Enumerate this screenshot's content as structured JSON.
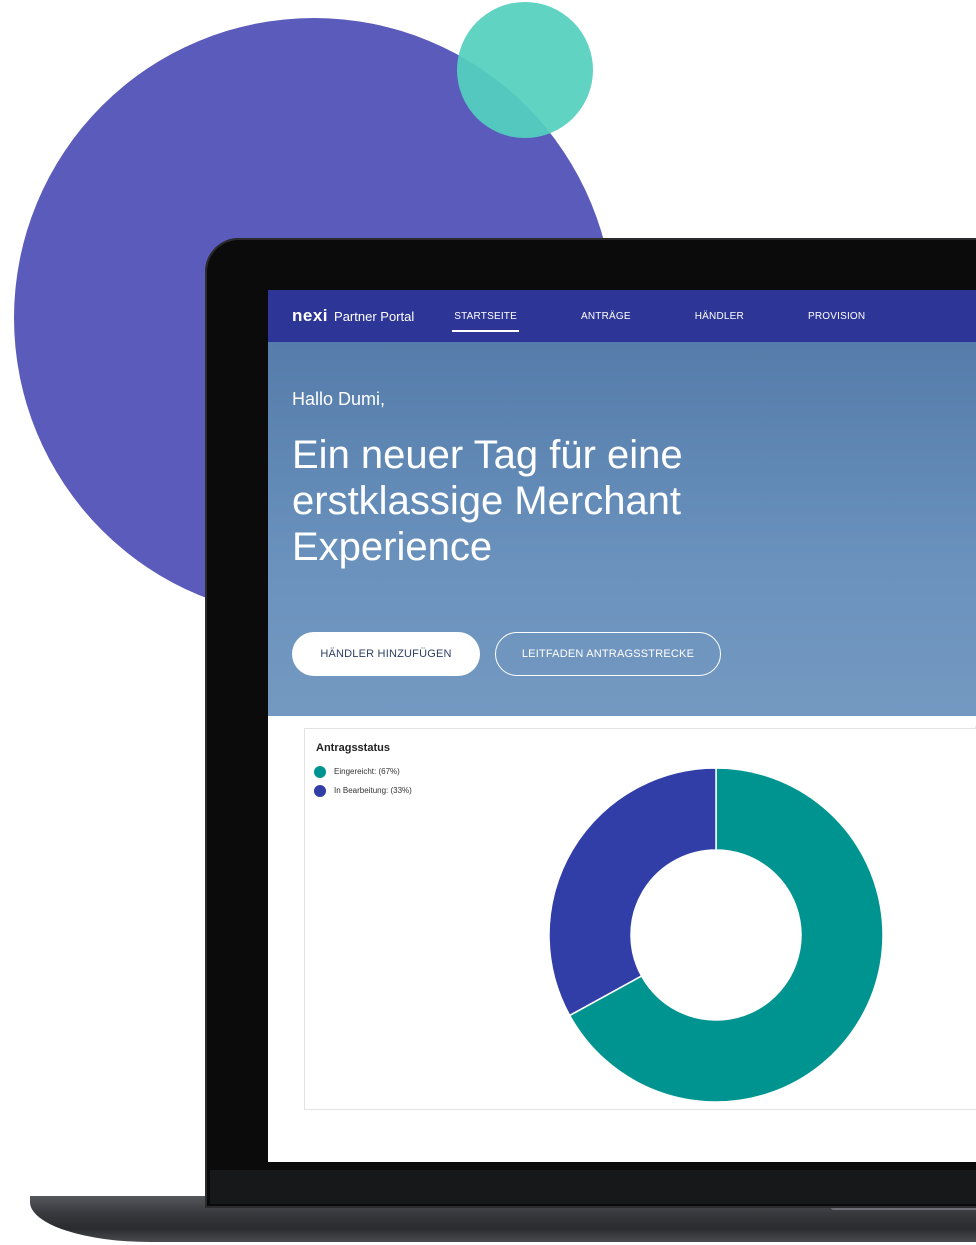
{
  "colors": {
    "nav_bg": "#2d3696",
    "hero_bg": "#6287b5",
    "accent_purple": "#5a5bbb",
    "accent_teal": "#54d0be",
    "series_submitted": "#009490",
    "series_in_progress": "#313ea7"
  },
  "navbar": {
    "logo": "nexi",
    "portal_name": "Partner Portal",
    "items": [
      {
        "label": "STARTSEITE",
        "active": true
      },
      {
        "label": "ANTRÄGE",
        "active": false
      },
      {
        "label": "HÄNDLER",
        "active": false
      },
      {
        "label": "PROVISION",
        "active": false
      }
    ]
  },
  "hero": {
    "greeting": "Hallo Dumi,",
    "headline": "Ein neuer Tag für eine erstklassige Merchant Experience",
    "primary_button": "HÄNDLER HINZUFÜGEN",
    "secondary_button": "LEITFADEN ANTRAGSSTRECKE"
  },
  "chart_data": {
    "type": "pie",
    "title": "Antragsstatus",
    "legend_position": "top-left",
    "series": [
      {
        "label": "Eingereicht: (67%)",
        "value": 67,
        "color": "#009490"
      },
      {
        "label": "In Bearbeitung: (33%)",
        "value": 33,
        "color": "#313ea7"
      }
    ]
  }
}
